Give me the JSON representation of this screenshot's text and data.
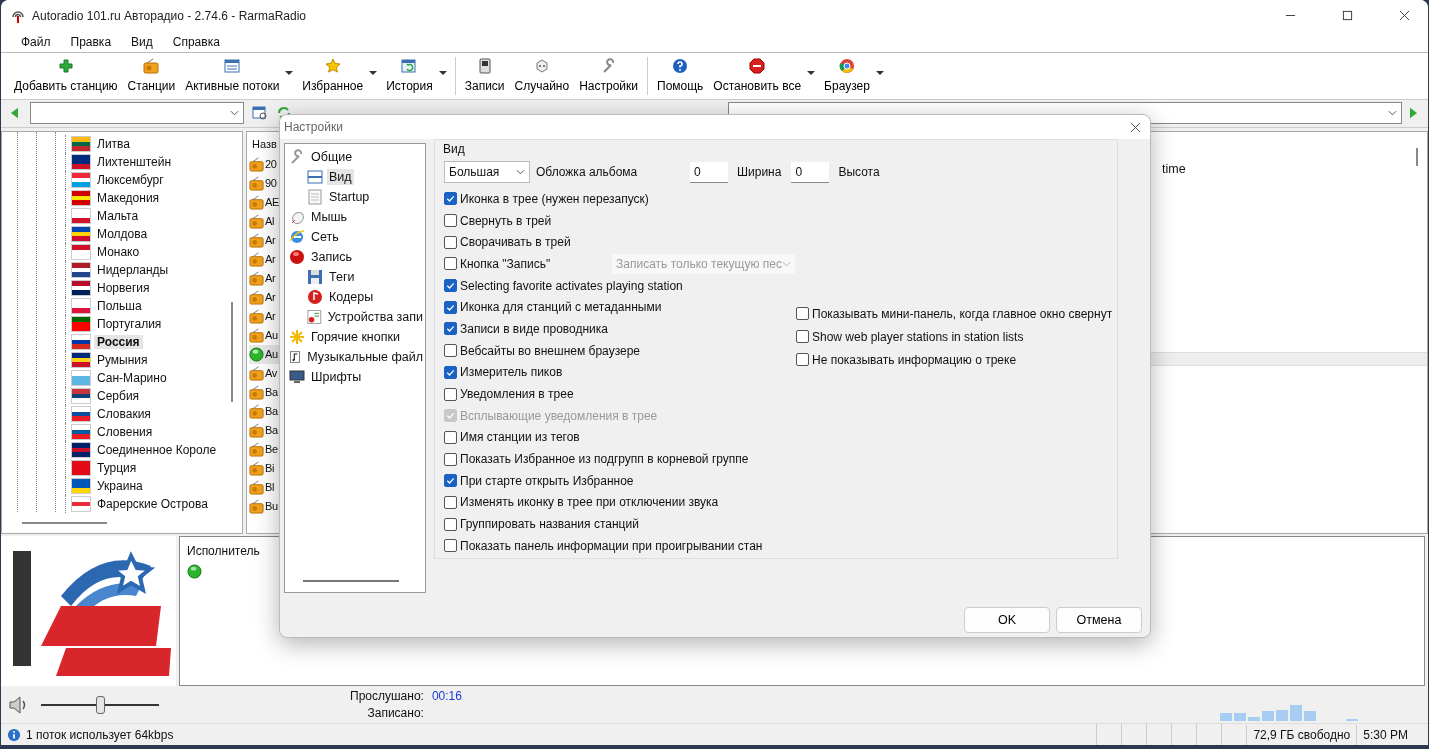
{
  "window": {
    "title": "Autoradio 101.ru Авторадио - 2.74.6 - RarmaRadio"
  },
  "menu": [
    "Файл",
    "Правка",
    "Вид",
    "Справка"
  ],
  "toolbar": [
    {
      "label": "Добавить станцию",
      "has_menu": false,
      "group_end": false
    },
    {
      "label": "Станции",
      "has_menu": false,
      "group_end": false
    },
    {
      "label": "Активные потоки",
      "has_menu": true,
      "group_end": false
    },
    {
      "label": "Избранное",
      "has_menu": true,
      "group_end": false
    },
    {
      "label": "История",
      "has_menu": true,
      "group_end": true
    },
    {
      "label": "Записи",
      "has_menu": false,
      "group_end": false
    },
    {
      "label": "Случайно",
      "has_menu": false,
      "group_end": false
    },
    {
      "label": "Настройки",
      "has_menu": false,
      "group_end": true
    },
    {
      "label": "Помощь",
      "has_menu": false,
      "group_end": false
    },
    {
      "label": "Остановить все",
      "has_menu": true,
      "group_end": false
    },
    {
      "label": "Браузер",
      "has_menu": true,
      "group_end": false
    }
  ],
  "countries": [
    {
      "name": "Литва",
      "selected": false
    },
    {
      "name": "Лихтенштейн",
      "selected": false
    },
    {
      "name": "Люксембург",
      "selected": false
    },
    {
      "name": "Македония",
      "selected": false
    },
    {
      "name": "Мальта",
      "selected": false
    },
    {
      "name": "Молдова",
      "selected": false
    },
    {
      "name": "Монако",
      "selected": false
    },
    {
      "name": "Нидерланды",
      "selected": false
    },
    {
      "name": "Норвегия",
      "selected": false
    },
    {
      "name": "Польша",
      "selected": false
    },
    {
      "name": "Португалия",
      "selected": false
    },
    {
      "name": "Россия",
      "selected": true
    },
    {
      "name": "Румыния",
      "selected": false
    },
    {
      "name": "Сан-Марино",
      "selected": false
    },
    {
      "name": "Сербия",
      "selected": false
    },
    {
      "name": "Словакия",
      "selected": false
    },
    {
      "name": "Словения",
      "selected": false
    },
    {
      "name": "Соединенное Короле",
      "selected": false
    },
    {
      "name": "Турция",
      "selected": false
    },
    {
      "name": "Украина",
      "selected": false
    },
    {
      "name": "Фарерские Острова",
      "selected": false
    }
  ],
  "stations": {
    "header": "Назв",
    "rows": [
      {
        "name": "20",
        "selected": false
      },
      {
        "name": "90",
        "selected": false
      },
      {
        "name": "AE",
        "selected": false
      },
      {
        "name": "Al",
        "selected": false
      },
      {
        "name": "Ar",
        "selected": false
      },
      {
        "name": "Ar",
        "selected": false
      },
      {
        "name": "Ar",
        "selected": false
      },
      {
        "name": "Ar",
        "selected": false
      },
      {
        "name": "Ar",
        "selected": false
      },
      {
        "name": "Au",
        "selected": false
      },
      {
        "name": "Au",
        "selected": true
      },
      {
        "name": "Av",
        "selected": false
      },
      {
        "name": "Ba",
        "selected": false
      },
      {
        "name": "Ba",
        "selected": false
      },
      {
        "name": "Ba",
        "selected": false
      },
      {
        "name": "Be",
        "selected": false
      },
      {
        "name": "Bi",
        "selected": false
      },
      {
        "name": "Bl",
        "selected": false
      },
      {
        "name": "Bu",
        "selected": false
      }
    ]
  },
  "info_panel": {
    "text": "time"
  },
  "now_playing": {
    "column_header": "Исполнитель",
    "playing": true
  },
  "player": {
    "volume": {
      "level": 0.5
    },
    "listened_label": "Прослушано:",
    "listened_value": "00:16",
    "recorded_label": "Записано:"
  },
  "status_bar": {
    "message": "1 поток использует 64kbps",
    "disk_free": "72,9 ГБ свободно",
    "time": "5:30 PM"
  },
  "dialog": {
    "title": "Настройки",
    "nav": [
      {
        "label": "Общие",
        "selected": false,
        "children": [
          {
            "label": "Вид",
            "selected": true
          },
          {
            "label": "Startup",
            "selected": false
          }
        ]
      },
      {
        "label": "Мышь",
        "selected": false
      },
      {
        "label": "Сеть",
        "selected": false
      },
      {
        "label": "Запись",
        "selected": false,
        "children": [
          {
            "label": "Теги",
            "selected": false
          },
          {
            "label": "Кодеры",
            "selected": false
          },
          {
            "label": "Устройства запи",
            "selected": false
          }
        ]
      },
      {
        "label": "Горячие кнопки",
        "selected": false
      },
      {
        "label": "Музыкальные файл",
        "selected": false
      },
      {
        "label": "Шрифты",
        "selected": false
      }
    ],
    "group_title": "Вид",
    "cover_size": "Большая",
    "cover_label": "Обложка альбома",
    "width": {
      "value": "0",
      "label": "Ширина"
    },
    "height": {
      "value": "0",
      "label": "Высота"
    },
    "options": [
      {
        "label": "Иконка в трее (нужен перезапуск)",
        "checked": true,
        "disabled": false
      },
      {
        "label": "Свернуть в трей",
        "checked": false,
        "disabled": false
      },
      {
        "label": "Сворачивать в трей",
        "checked": false,
        "disabled": false
      },
      {
        "label": "Кнопка \"Запись\"",
        "checked": false,
        "disabled": false,
        "select": {
          "value": "Записать только текущую пес",
          "disabled": true
        }
      },
      {
        "label": "Selecting favorite activates playing station",
        "checked": true,
        "disabled": false
      },
      {
        "label": "Иконка для станций с метаданными",
        "checked": true,
        "disabled": false
      },
      {
        "label": "Записи в виде проводника",
        "checked": true,
        "disabled": false
      },
      {
        "label": "Вебсайты во внешнем браузере",
        "checked": false,
        "disabled": false
      },
      {
        "label": "Измеритель пиков",
        "checked": true,
        "disabled": false
      },
      {
        "label": "Уведомления в трее",
        "checked": false,
        "disabled": false
      },
      {
        "label": "Всплывающие уведомления в трее",
        "checked": true,
        "disabled": true
      },
      {
        "label": "Имя станции из тегов",
        "checked": false,
        "disabled": false
      },
      {
        "label": "Показать Избранное из подгрупп в корневой группе",
        "checked": false,
        "disabled": false
      },
      {
        "label": "При старте открыть Избранное",
        "checked": true,
        "disabled": false
      },
      {
        "label": "Изменять иконку в трее при отключении звука",
        "checked": false,
        "disabled": false
      },
      {
        "label": "Группировать названия станций",
        "checked": false,
        "disabled": false
      },
      {
        "label": "Показать панель информации при проигрывании стан",
        "checked": false,
        "disabled": false
      }
    ],
    "right_options": [
      {
        "label": "Показывать мини-панель, когда главное окно свернут",
        "checked": false,
        "disabled": false
      },
      {
        "label": "Show web player stations in station lists",
        "checked": false,
        "disabled": false
      },
      {
        "label": "Не показывать информацию о треке",
        "checked": false,
        "disabled": false
      }
    ],
    "buttons": [
      "OK",
      "Отмена"
    ]
  }
}
